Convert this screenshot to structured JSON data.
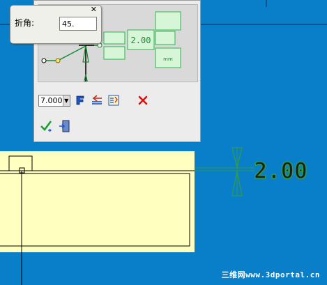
{
  "angle_popup": {
    "label": "折角:",
    "value": "45.",
    "close_glyph": "✕"
  },
  "dimension_dialog": {
    "preview_value": "2.00",
    "preview_unit": "mm",
    "text_size": "7.000",
    "icons": [
      "font-icon",
      "text-align-icon",
      "style-settings-icon",
      "delete-icon",
      "ok-check-icon",
      "exit-icon"
    ]
  },
  "drawing": {
    "dimension_text": "2.00"
  },
  "watermark": "三维网www.3dportal.cn",
  "colors": {
    "viewport_background": "#0a7fc9",
    "part_face": "#ffffc0",
    "dimension_green": "#2f9b4b",
    "preview_green": "#2fb34e"
  }
}
